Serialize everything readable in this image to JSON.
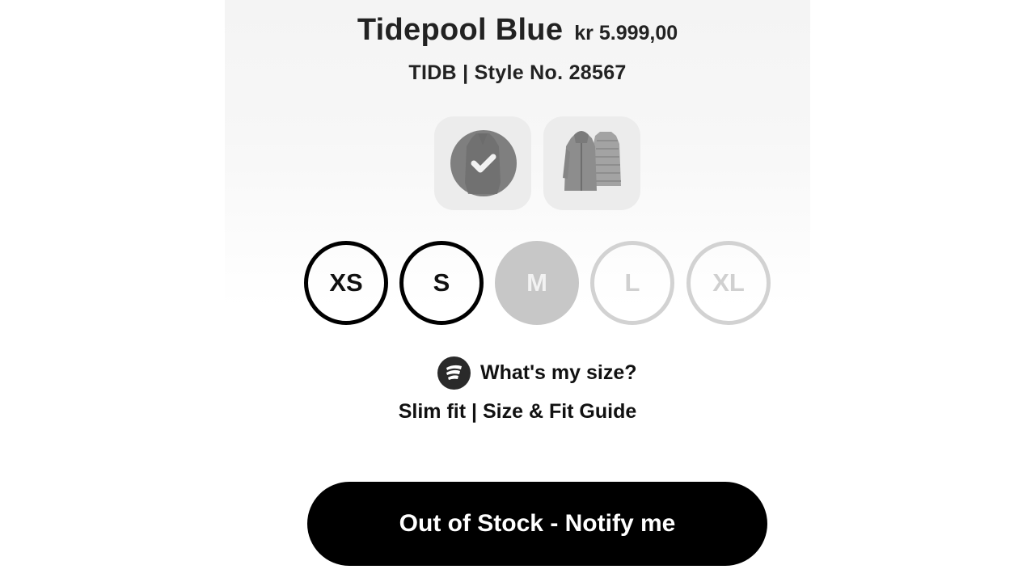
{
  "product": {
    "color_name": "Tidepool Blue",
    "price": "kr 5.999,00",
    "style_line": "TIDB | Style No. 28567"
  },
  "color_swatches": [
    {
      "icon": "jacket-thumbnail-front",
      "selected": true
    },
    {
      "icon": "jacket-thumbnail-pair",
      "selected": false
    }
  ],
  "sizes": [
    {
      "label": "XS",
      "state": "available"
    },
    {
      "label": "S",
      "state": "available"
    },
    {
      "label": "M",
      "state": "selected"
    },
    {
      "label": "L",
      "state": "unavailable"
    },
    {
      "label": "XL",
      "state": "unavailable"
    }
  ],
  "fit_finder": {
    "icon": "fit-finder-icon",
    "label": "What's my size?"
  },
  "fit_guide": {
    "fit_text": "Slim fit",
    "separator": "|",
    "guide_link": "Size & Fit Guide"
  },
  "cta": {
    "label": "Out of Stock - Notify me"
  },
  "colors": {
    "cta_background": "#000000",
    "size_selected": "#c7c7c7",
    "size_unavailable": "#d2d2d2",
    "thumb_background": "#ececec"
  }
}
